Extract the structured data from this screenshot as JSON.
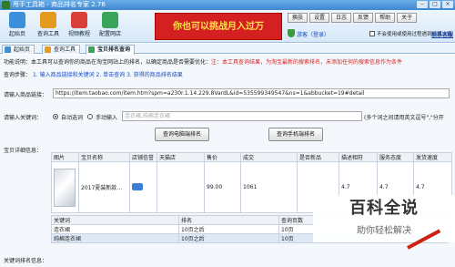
{
  "window": {
    "title": "甩手工具箱 - 商品排名专家 2.76",
    "min": "–",
    "max": "□",
    "close": "×"
  },
  "toolbar": [
    {
      "label": "起始页",
      "color": "#3c8fd9"
    },
    {
      "label": "查询工具",
      "color": "#e39a1e"
    },
    {
      "label": "视频教程",
      "color": "#d9403a"
    },
    {
      "label": "配置网店",
      "color": "#3aa55a"
    }
  ],
  "banner": "你也可以挑战月入过万",
  "topbuttons": [
    "换肤",
    "设置",
    "日志",
    "反馈",
    "帮助",
    "关于"
  ],
  "account": {
    "status": "游客（登录）",
    "note": "不会使用或使用过程遇到问题，请",
    "free": "联系客服"
  },
  "tabs": [
    {
      "label": "起始页",
      "color": "#3c8fd9"
    },
    {
      "label": "查询工具",
      "color": "#e39a1e"
    },
    {
      "label": "宝贝排名查询",
      "color": "#3aa55a",
      "active": true
    }
  ],
  "main": {
    "func_label": "功能说明：",
    "func_text": "本工具可以查询你的商品在淘宝网站上的排名，以确定商品是否需要优化：",
    "func_red": "注：本工具查询结果，为淘宝最新的搜索排名，未添加任何的搜索信息作为条件",
    "steps_label": "查询步骤：",
    "steps": [
      "1. 输入商品链接和关键词",
      "2. 单击查询",
      "3. 获得的商品排名结果"
    ],
    "url_label": "请输入商品链接：",
    "url_value": "https://item.taobao.com/item.htm?spm=a230r.1.14.229.8VardL&id=535599349547&ns=1&abbucket=19#detail",
    "kw_label": "请输入关键词：",
    "radio_auto": "自动选词",
    "radio_manual": "手动输入",
    "kw_placeholder": "连衣裙,纯棉连衣裙",
    "kw_hint": "(多个词之间请用英文逗号\",\"分开",
    "btn_pc": "查询电脑端排名",
    "btn_mobile": "查询手机端排名",
    "detail_label": "宝贝详细信息：",
    "kwrank_label": "关键词排名信息："
  },
  "product_table": {
    "headers": [
      "图片",
      "宝贝名称",
      "店铺信誉",
      "天猫店",
      "售价",
      "成交",
      "是否新品",
      "描述相符",
      "服务态度",
      "发货速度"
    ],
    "row": [
      "",
      "2017夏装新款…",
      "",
      "",
      "99.00",
      "1061",
      "",
      "4.7",
      "4.7",
      "4.7"
    ]
  },
  "keyword_table": {
    "headers": [
      "关键词",
      "排名",
      "查询页数"
    ],
    "rows": [
      [
        "连衣裙",
        "10页之后",
        "10页"
      ],
      [
        "纯棉连衣裙",
        "10页之后",
        "10页"
      ]
    ]
  },
  "watermark": {
    "big": "百科全说",
    "small": "助你轻松解决"
  }
}
